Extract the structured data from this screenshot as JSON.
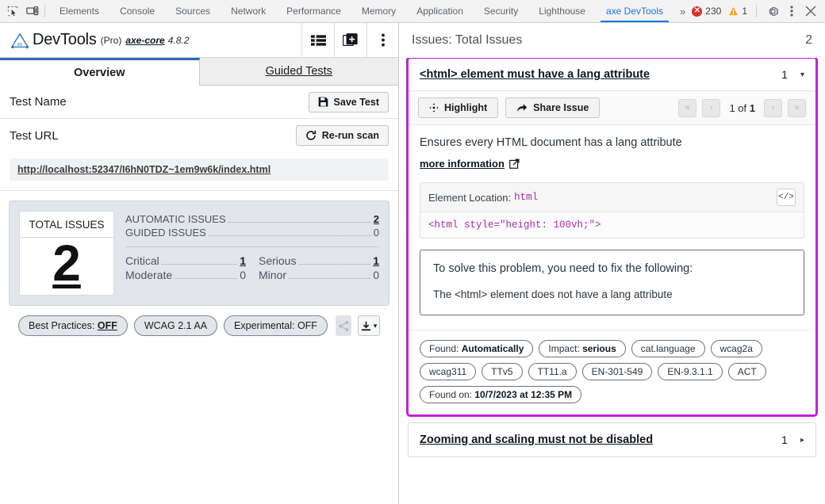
{
  "devtools": {
    "icons": {
      "inspect": "inspect-element-icon",
      "device": "device-toolbar-icon"
    },
    "tabs": [
      {
        "label": "Elements",
        "active": false
      },
      {
        "label": "Console",
        "active": false
      },
      {
        "label": "Sources",
        "active": false
      },
      {
        "label": "Network",
        "active": false
      },
      {
        "label": "Performance",
        "active": false
      },
      {
        "label": "Memory",
        "active": false
      },
      {
        "label": "Application",
        "active": false
      },
      {
        "label": "Security",
        "active": false
      },
      {
        "label": "Lighthouse",
        "active": false
      },
      {
        "label": "axe DevTools",
        "active": true
      }
    ],
    "overflow": "»",
    "errors": "230",
    "warnings": "1",
    "accent": "#1a73e8",
    "error_color": "#dd2c2c",
    "warning_color": "#f5a623"
  },
  "axe_header": {
    "logo": "axe-logo",
    "title": "DevTools",
    "edition": "(Pro)",
    "core_label": "axe-core",
    "version": "4.8.2",
    "actions": [
      "list-view-icon",
      "new-window-icon",
      "kebab-menu-icon"
    ]
  },
  "pane_tabs": [
    {
      "label": "Overview",
      "active": true
    },
    {
      "label": "Guided Tests",
      "active": false
    }
  ],
  "test": {
    "name_label": "Test Name",
    "save_label": "Save Test",
    "save_icon": "save-icon",
    "url_label": "Test URL",
    "rerun_label": "Re-run scan",
    "rerun_icon": "refresh-icon",
    "url": "http://localhost:52347/I6hN0TDZ~1em9w6k/index.html"
  },
  "summary": {
    "total_caption": "TOTAL ISSUES",
    "total_value": "2",
    "rows": [
      {
        "label": "AUTOMATIC ISSUES",
        "value": "2",
        "is_link": true
      },
      {
        "label": "GUIDED ISSUES",
        "value": "0",
        "is_link": false
      }
    ],
    "severity": [
      {
        "label": "Critical",
        "value": "1",
        "is_link": true
      },
      {
        "label": "Serious",
        "value": "1",
        "is_link": true
      },
      {
        "label": "Moderate",
        "value": "0",
        "is_link": false
      },
      {
        "label": "Minor",
        "value": "0",
        "is_link": false
      }
    ],
    "pills": [
      {
        "prefix": "Best Practices: ",
        "strong": "OFF"
      },
      {
        "prefix": "WCAG 2.1 AA",
        "strong": ""
      },
      {
        "prefix": "Experimental: OFF",
        "strong": ""
      }
    ],
    "share_icon": "share-icon",
    "download_icon": "download-icon",
    "download_caret": "▾"
  },
  "issues": {
    "header_label": "Issues: Total Issues",
    "header_count": "2",
    "focus_color": "#c124d4",
    "selected": {
      "title": "<html> element must have a lang attribute",
      "count": "1",
      "caret": "▾",
      "toolbar": {
        "highlight_label": "Highlight",
        "highlight_icon": "crosshair-icon",
        "share_label": "Share Issue",
        "share_icon": "share-arrow-icon",
        "pager": {
          "first": "«",
          "prev": "‹",
          "next": "›",
          "last": "»",
          "current": "1",
          "of": " of ",
          "total": "1"
        }
      },
      "description": "Ensures every HTML document has a lang attribute",
      "more_information": "more information",
      "more_info_icon": "external-link-icon",
      "element_location_label": "Element Location:",
      "element_selector": "html",
      "code_icon": "code-brackets-icon",
      "code_snippet": "<html style=\"height: 100vh;\">",
      "solve_title": "To solve this problem, you need to fix the following:",
      "solve_detail": "The <html> element does not have a lang attribute",
      "tags": [
        {
          "prefix": "Found: ",
          "strong": "Automatically"
        },
        {
          "prefix": "Impact: ",
          "strong": "serious"
        },
        {
          "prefix": "cat.language",
          "strong": ""
        },
        {
          "prefix": "wcag2a",
          "strong": ""
        },
        {
          "prefix": "wcag311",
          "strong": ""
        },
        {
          "prefix": "TTv5",
          "strong": ""
        },
        {
          "prefix": "TT11.a",
          "strong": ""
        },
        {
          "prefix": "EN-301-549",
          "strong": ""
        },
        {
          "prefix": "EN-9.3.1.1",
          "strong": ""
        },
        {
          "prefix": "ACT",
          "strong": ""
        },
        {
          "prefix": "Found on: ",
          "strong": "10/7/2023 at 12:35 PM"
        }
      ]
    },
    "collapsed": {
      "title": "Zooming and scaling must not be disabled",
      "count": "1",
      "caret": "▸"
    }
  }
}
